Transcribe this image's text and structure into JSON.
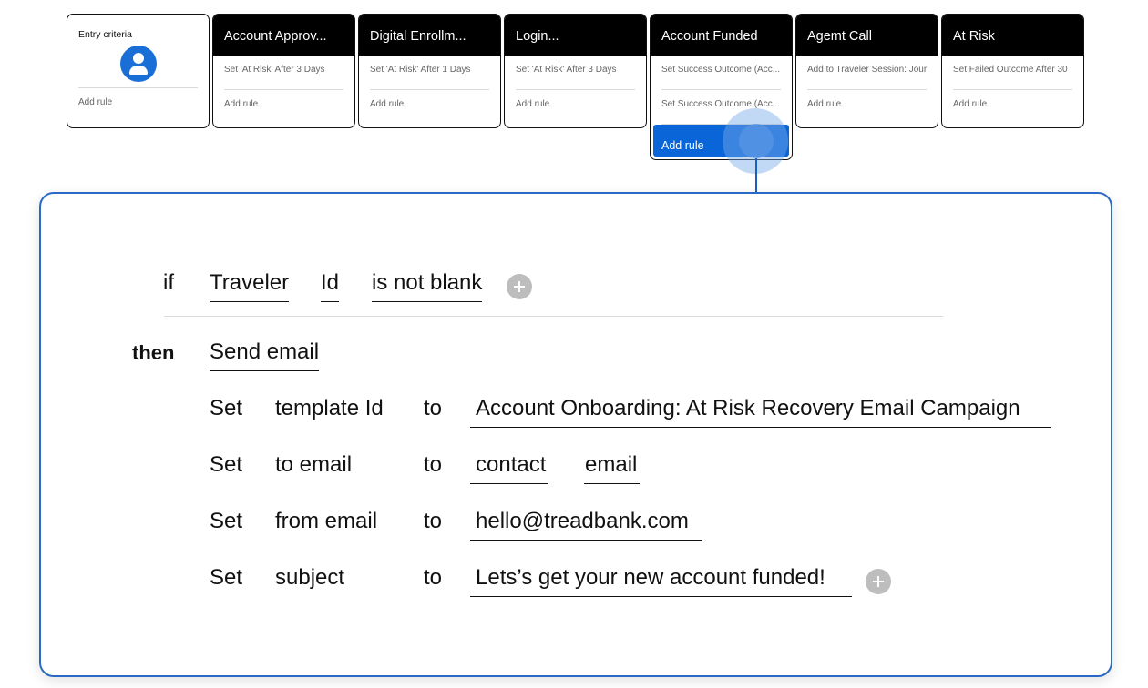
{
  "stages": {
    "entry": {
      "title": "Entry criteria",
      "icon": "user-icon",
      "add_rule": "Add rule"
    },
    "cards": [
      {
        "title": "Account Approv...",
        "rules": [
          "Set 'At Risk' After 3 Days"
        ],
        "add_rule": "Add rule"
      },
      {
        "title": "Digital Enrollm...",
        "rules": [
          "Set 'At Risk' After 1 Days"
        ],
        "add_rule": "Add rule"
      },
      {
        "title": "Login...",
        "rules": [
          "Set 'At Risk' After 3 Days"
        ],
        "add_rule": "Add rule"
      },
      {
        "title": "Account Funded",
        "rules": [
          "Set Success Outcome (Acc...",
          "Set Success Outcome (Acc..."
        ],
        "add_rule": "Add rule",
        "active": true
      },
      {
        "title": "Agemt Call",
        "rules": [
          "Add to Traveler Session: Jour"
        ],
        "add_rule": "Add rule"
      },
      {
        "title": "At Risk",
        "rules": [
          "Set Failed Outcome After 30"
        ],
        "add_rule": "Add rule"
      }
    ]
  },
  "editor": {
    "condition": {
      "keyword": "if",
      "object": "Traveler",
      "field": "Id",
      "operator": "is not blank"
    },
    "action": {
      "keyword": "then",
      "type": "Send email",
      "assignments": [
        {
          "verb": "Set",
          "property": "template Id",
          "connector": "to",
          "values": [
            "Account Onboarding: At Risk Recovery Email Campaign"
          ]
        },
        {
          "verb": "Set",
          "property": "to email",
          "connector": "to",
          "values": [
            "contact",
            "email"
          ]
        },
        {
          "verb": "Set",
          "property": "from email",
          "connector": "to",
          "values": [
            "hello@treadbank.com"
          ]
        },
        {
          "verb": "Set",
          "property": "subject",
          "connector": "to",
          "values": [
            "Lets’s get your new account funded!"
          ]
        }
      ]
    }
  },
  "colors": {
    "accent": "#0a66d8",
    "panel_border": "#2a6ac6",
    "card_header": "#000000",
    "plus_button": "#bdbdbd"
  }
}
